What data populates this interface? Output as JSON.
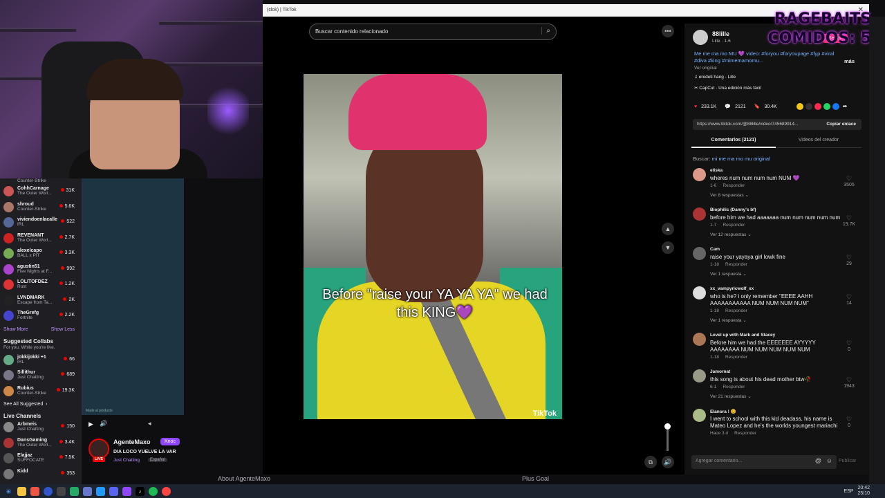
{
  "twitch": {
    "sidebar": {
      "top_partial": {
        "game": "Counter-Strike"
      },
      "channels": [
        {
          "name": "CohhCarnage",
          "game": "The Outer Worl...",
          "viewers": "31K",
          "color": "#c55"
        },
        {
          "name": "shroud",
          "game": "Counter-Strike",
          "viewers": "5.6K",
          "color": "#a76"
        },
        {
          "name": "viviendoenlacalle",
          "game": "IRL",
          "viewers": "522",
          "color": "#569"
        },
        {
          "name": "REVENANT",
          "game": "The Outer Worl...",
          "viewers": "2.7K",
          "color": "#c22"
        },
        {
          "name": "alexelcapo",
          "game": "BALL x PIT",
          "viewers": "3.3K",
          "color": "#7a5"
        },
        {
          "name": "agustin51",
          "game": "Five Nights at F...",
          "viewers": "992",
          "color": "#a4c"
        },
        {
          "name": "LOLITOFDEZ",
          "game": "Rust",
          "viewers": "1.2K",
          "color": "#d33"
        },
        {
          "name": "LVNDMARK",
          "game": "Escape from Ta...",
          "viewers": "2K",
          "color": "#222"
        },
        {
          "name": "TheGrefg",
          "game": "Fortnite",
          "viewers": "2.2K",
          "color": "#44c"
        }
      ],
      "show_more": "Show More",
      "show_less": "Show Less",
      "suggested_title": "Suggested Collabs",
      "suggested_sub": "For you. While you're live.",
      "suggested": [
        {
          "name": "jokkijokki +1",
          "game": "IRL",
          "viewers": "66",
          "color": "#6a8"
        },
        {
          "name": "Sillithur",
          "game": "Just Chatting",
          "viewers": "689",
          "color": "#778"
        },
        {
          "name": "Rubius",
          "game": "Counter-Strike",
          "viewers": "19.3K",
          "color": "#c84"
        }
      ],
      "see_all": "See All Suggested",
      "live_title": "Live Channels",
      "live": [
        {
          "name": "Arbmeis",
          "game": "Just Chatting",
          "viewers": "150",
          "color": "#888"
        },
        {
          "name": "DansGaming",
          "game": "The Outer Worl...",
          "viewers": "3.4K",
          "color": "#a33"
        },
        {
          "name": "Elajjaz",
          "game": "SUFFOCATE",
          "viewers": "7.5K",
          "color": "#555"
        },
        {
          "name": "Kidd",
          "game": "",
          "viewers": "353",
          "color": "#777"
        }
      ]
    },
    "player": {
      "small_text": "Made al producto"
    },
    "stream": {
      "channel": "AgenteMaxo",
      "title": "DIA LOCO VUELVE LA VAR",
      "category": "Just Chatting",
      "language": "Español",
      "live_badge": "LIVE",
      "knock": "Knoc"
    },
    "about": "About AgenteMaxo",
    "plus_goal": "Plus Goal"
  },
  "tiktok": {
    "window_title": "(clok) | TikTok",
    "search_placeholder": "Buscar contenido relacionado",
    "caption": "Before \"raise your YA YA YA\" we had this KING💜",
    "logo": "TikTok",
    "author": {
      "name": "88lille",
      "sub": "Lille · 1-6"
    },
    "follow": "Seguir",
    "description": "Me me ma mo MU 💜 video: #foryou #foryoupage #fyp #viral #diva #king #mimemamomu...",
    "more": "más",
    "original": "Ver original",
    "sound": "eredeti hang - Lille",
    "capcut": "CapCut · Una edición más fácil",
    "stats": {
      "likes": "233.1K",
      "comments": "2121",
      "saves": "30.4K"
    },
    "link": "https://www.tiktok.com/@88lille/video/745689914...",
    "copy_link": "Copiar enlace",
    "tabs": [
      "Comentarios (2121)",
      "Videos del creador"
    ],
    "search_label": "Buscar:",
    "search_term": "mi me ma mo mu original",
    "comments": [
      {
        "user": "eliska",
        "text": "wheres num num num num NUM 💜",
        "meta": "1-6",
        "reply": "Responder",
        "likes": "3505",
        "replies": "Ver 8 respuestas",
        "color": "#d98"
      },
      {
        "user": "Biophilic (Danny's bf)",
        "text": "before him we had aaaaaaa num num num num num",
        "meta": "1-7",
        "reply": "Responder",
        "likes": "19.7K",
        "replies": "Ver 12 respuestas",
        "color": "#a33"
      },
      {
        "user": "Cam",
        "text": "raise your yayaya girl lowk fine",
        "meta": "1-18",
        "reply": "Responder",
        "likes": "29",
        "replies": "Ver 1 respuesta",
        "color": "#666"
      },
      {
        "user": "xx_vampyricwolf_xx",
        "text": "who is he? i only remember \"EEEE AAHH AAAAAAAAAAA NUM NUM NUM NUM\"",
        "meta": "1-18",
        "reply": "Responder",
        "likes": "14",
        "replies": "Ver 1 respuesta",
        "color": "#ddd"
      },
      {
        "user": "Level up with Mark and Stacey",
        "text": "Before him we had the EEEEEEE AYYYYY AAAAAAAA NUM NUM NUM NUM NUM",
        "meta": "1-18",
        "reply": "Responder",
        "likes": "0",
        "replies": "",
        "color": "#a75"
      },
      {
        "user": "Jamornat",
        "text": "this song is about his dead mother btw🥀",
        "meta": "6-1",
        "reply": "Responder",
        "likes": "1943",
        "replies": "Ver 21 respuestas",
        "color": "#998"
      },
      {
        "user": "Elanora ! 😊",
        "text": "I went to school with this kid deadass, his name is Mateo Lopez and he's the worlds youngest mariachi",
        "meta": "Hace 3 d",
        "reply": "Responder",
        "likes": "0",
        "replies": "",
        "color": "#ab8"
      }
    ],
    "add_comment": "Agregar comentario...",
    "publish": "Publicar"
  },
  "overlay": {
    "line1": "RAGEBAITS",
    "line2": "COMIDOS: 5"
  },
  "taskbar": {
    "lang": "ESP",
    "time": "20:42",
    "date": "25/10"
  }
}
